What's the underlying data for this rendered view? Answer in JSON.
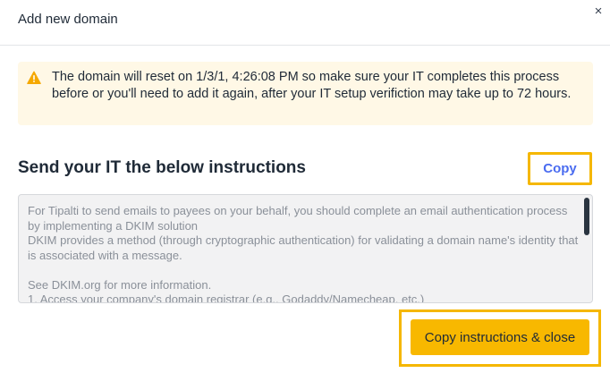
{
  "dialog": {
    "title": "Add new domain",
    "close_icon": "close-icon",
    "close_glyph": "×"
  },
  "alert": {
    "icon": "warning-icon",
    "text": "The domain will reset on 1/3/1, 4:26:08 PM so make sure your IT completes this process before or you'll need to add it again, after your IT setup verifiction may take up to 72 hours."
  },
  "instructions": {
    "heading": "Send your IT the below instructions",
    "copy_label": "Copy",
    "body": "For Tipalti to send emails to payees on your behalf, you should complete an email authentication process by implementing a DKIM solution\nDKIM provides a method (through cryptographic authentication) for validating a domain name's identity that is associated with a message.\n\nSee DKIM.org for more information.\n1. Access your company's domain registrar (e.g., Godaddy/Namecheap, etc.)"
  },
  "footer": {
    "primary_label": "Copy instructions & close"
  },
  "colors": {
    "accent": "#f5b700",
    "link": "#4a6cf0",
    "alert_bg": "#fff8e6"
  }
}
